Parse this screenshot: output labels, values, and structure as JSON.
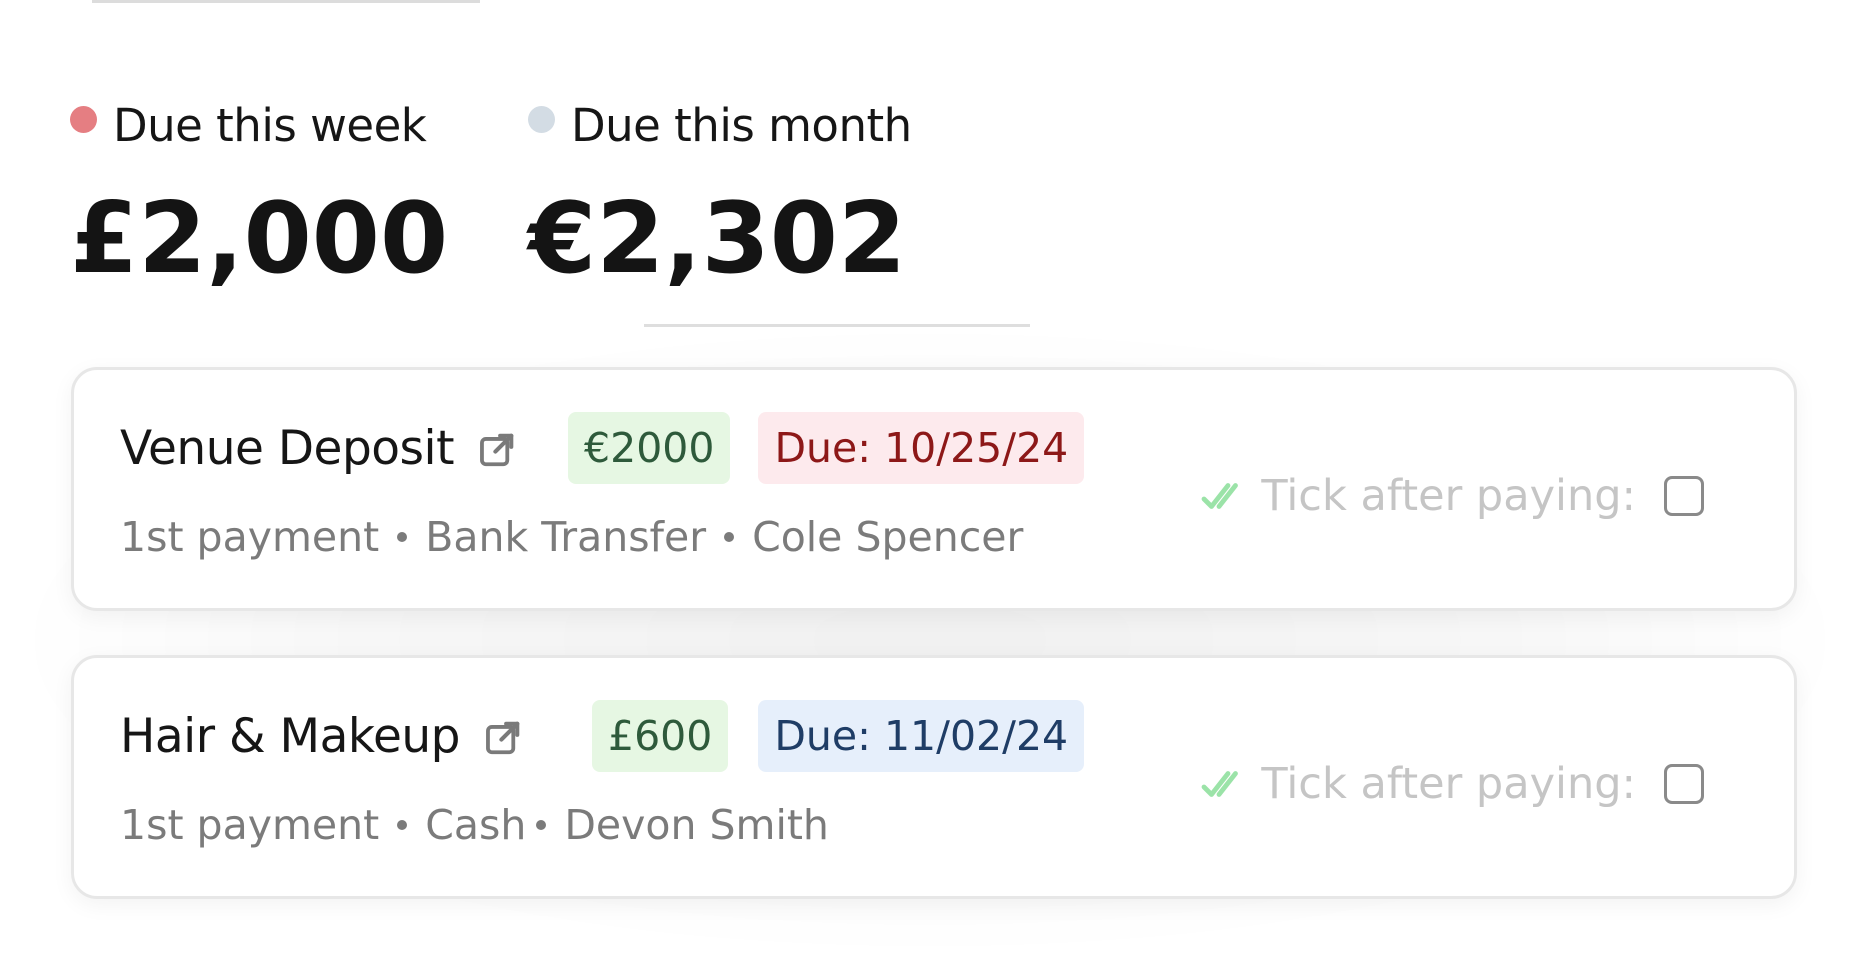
{
  "summary": {
    "week": {
      "label": "Due this week",
      "amount": "£2,000",
      "dot_color": "#e57e82"
    },
    "month": {
      "label": "Due this month",
      "amount": "€2,302",
      "dot_color": "#d3dce4"
    }
  },
  "payments": [
    {
      "title": "Venue Deposit",
      "link_icon": "external-link-icon",
      "amount": "€2000",
      "due": "Due: 10/25/24",
      "due_color": "red",
      "details": [
        "1st payment",
        "Bank Transfer",
        "Cole Spencer"
      ],
      "tick_label": "Tick after paying:",
      "checked": false
    },
    {
      "title": "Hair & Makeup",
      "link_icon": "external-link-icon",
      "amount": "£600",
      "due": "Due: 11/02/24",
      "due_color": "blue",
      "details": [
        "1st payment",
        "Cash",
        "Devon Smith"
      ],
      "tick_label": "Tick after paying:",
      "checked": false
    }
  ],
  "colors": {
    "tick_icon": "#9be3a8",
    "amount_badge_bg": "#e6f7e3",
    "due_red_bg": "#fdeaed",
    "due_blue_bg": "#e6effb"
  }
}
